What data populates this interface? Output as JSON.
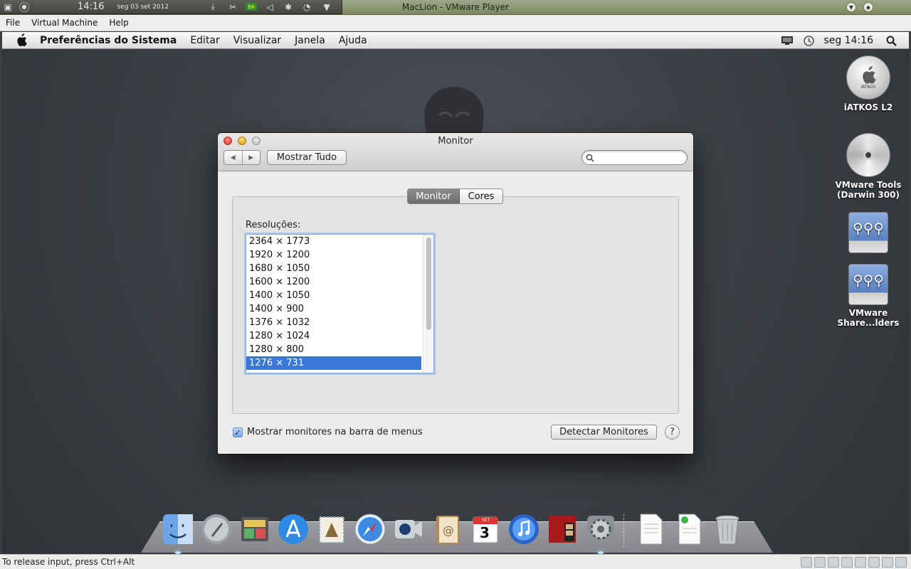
{
  "host": {
    "clock": "14:16",
    "date": "seg 03 set 2012",
    "window_title": "MacLion - VMware Player",
    "status_text": "To release input, press Ctrl+Alt"
  },
  "vmware_menu": {
    "file": "File",
    "virtual_machine": "Virtual Machine",
    "help": "Help"
  },
  "mac_menubar": {
    "app_name": "Preferências do Sistema",
    "items": [
      "Editar",
      "Visualizar",
      "Janela",
      "Ajuda"
    ],
    "clock": "seg 14:16"
  },
  "desktop_icons": [
    {
      "label_line1": "iATKOS L2",
      "label_line2": "",
      "badge": "iATKOS"
    },
    {
      "label_line1": "VMware Tools",
      "label_line2": "(Darwin 300)"
    },
    {
      "label_line1": "",
      "label_line2": ""
    },
    {
      "label_line1": "VMware",
      "label_line2": "Share...lders"
    }
  ],
  "window": {
    "title": "Monitor",
    "show_all": "Mostrar Tudo",
    "search": {
      "value": "",
      "placeholder": ""
    },
    "tabs": [
      "Monitor",
      "Cores"
    ],
    "active_tab": "Monitor",
    "resolutions_label": "Resoluções:",
    "resolutions": [
      "2364 × 1773",
      "1920 × 1200",
      "1680 × 1050",
      "1600 × 1200",
      "1400 × 1050",
      "1400 × 900",
      "1376 × 1032",
      "1280 × 1024",
      "1280 × 800",
      "1276 × 731"
    ],
    "selected_resolution": "1276 × 731",
    "show_in_menubar_label": "Mostrar monitores na barra de menus",
    "show_in_menubar_checked": true,
    "detect_button": "Detectar Monitores",
    "help_button": "?"
  },
  "dock": {
    "calendar": {
      "month": "SET",
      "day": "3"
    },
    "apps": [
      "finder-icon",
      "launchpad-icon",
      "photo-browser-icon",
      "app-store-icon",
      "mail-icon",
      "safari-icon",
      "facetime-icon",
      "address-book-icon",
      "ical-icon",
      "itunes-icon",
      "photo-booth-icon",
      "system-preferences-icon"
    ],
    "others": [
      "document-icon",
      "downloads-stack-icon",
      "trash-icon"
    ]
  },
  "colors": {
    "selection": "#3a78d8",
    "desktop": "#3c3f45"
  }
}
